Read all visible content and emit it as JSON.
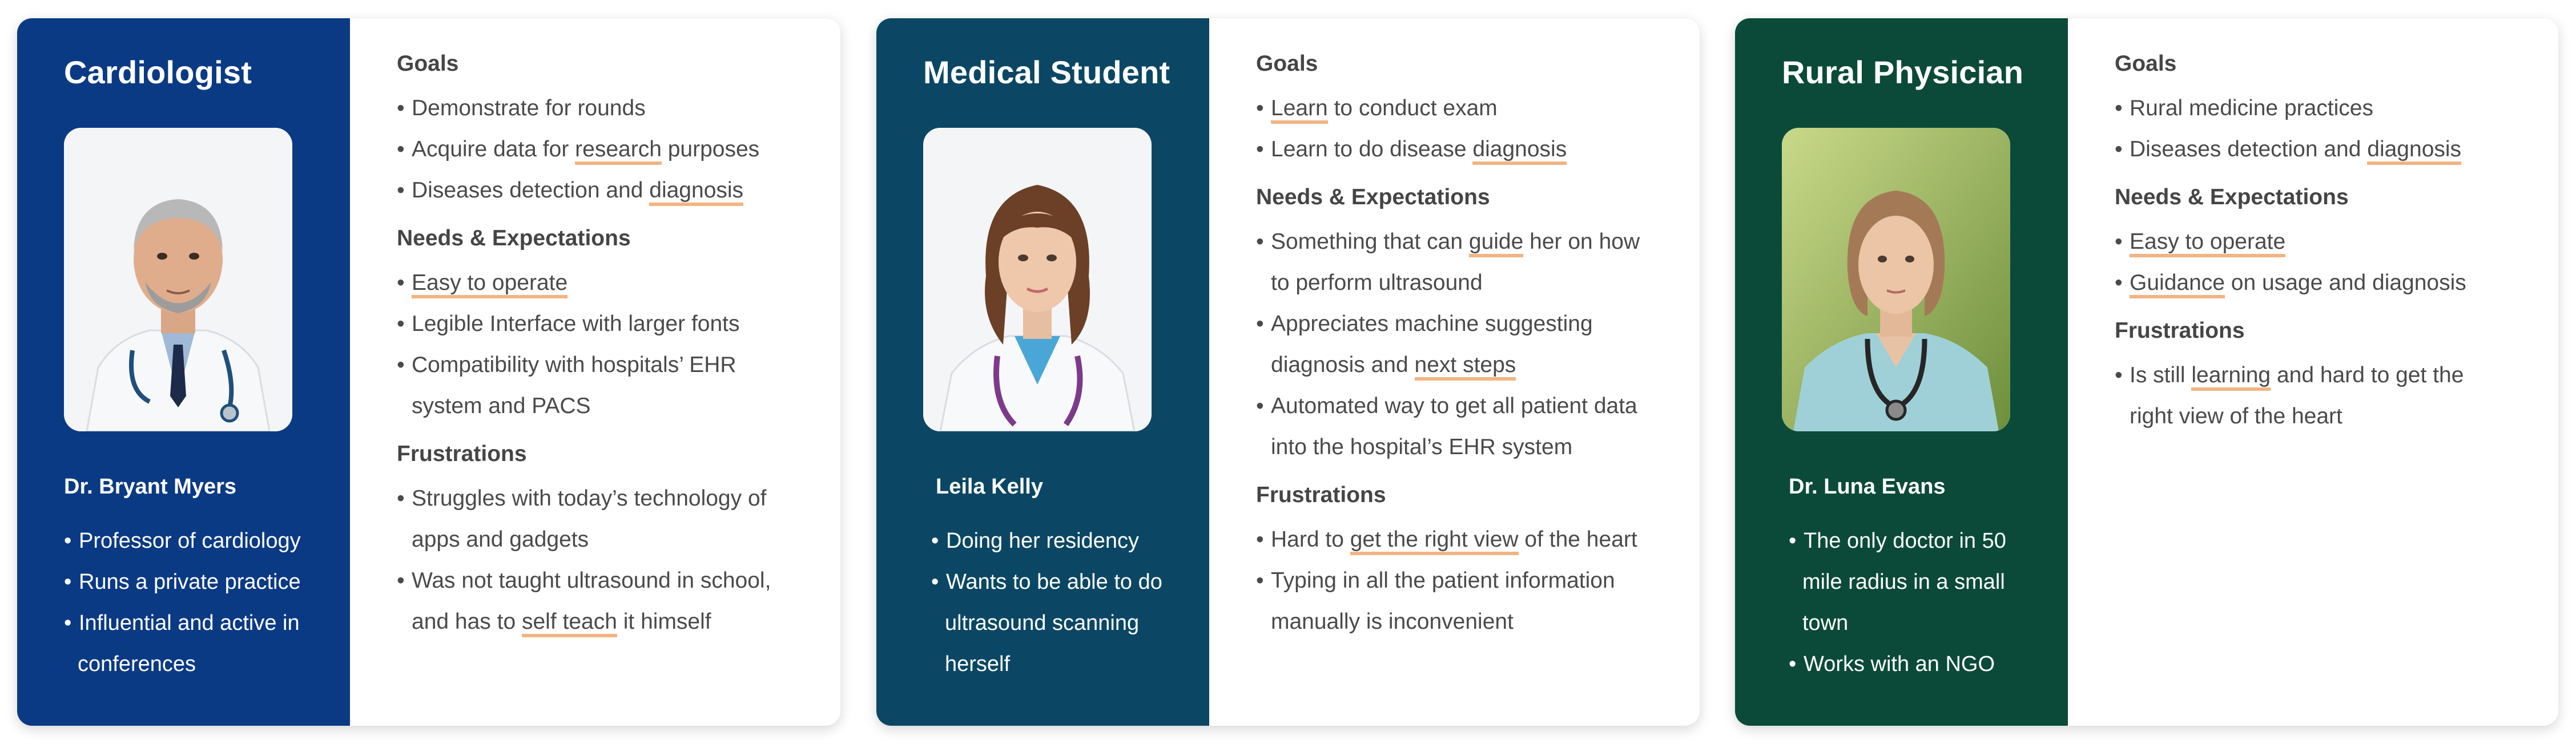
{
  "personas": [
    {
      "role": "Cardiologist",
      "photo_alt": "",
      "name": "Dr. Bryant Myers",
      "about": [
        "Professor of cardiology",
        "Runs a private practice",
        "Influential and active in conferences"
      ],
      "sections": [
        {
          "title": "Goals",
          "items": [
            [
              "Demonstrate for rounds"
            ],
            [
              "Acquire data for ",
              {
                "hl": "research"
              },
              " purposes"
            ],
            [
              "Diseases detection and ",
              {
                "hl": "diagnosis"
              }
            ]
          ]
        },
        {
          "title": "Needs & Expectations",
          "items": [
            [
              {
                "hl": "Easy to operate"
              }
            ],
            [
              "Legible Interface with larger fonts"
            ],
            [
              "Compatibility with hospitals’ EHR system and PACS"
            ]
          ]
        },
        {
          "title": "Frustrations",
          "items": [
            [
              "Struggles with today’s technology of apps and gadgets"
            ],
            [
              "Was not taught ultrasound in school, and has to ",
              {
                "hl": "self teach"
              },
              " it himself"
            ]
          ]
        }
      ],
      "colors": {
        "panel": "#0b3a85"
      }
    },
    {
      "role": "Medical Student",
      "name": "Leila Kelly",
      "about": [
        "Doing her residency",
        "Wants to be able to do ultrasound scanning herself"
      ],
      "sections": [
        {
          "title": "Goals",
          "items": [
            [
              {
                "hl": "Learn"
              },
              " to conduct exam"
            ],
            [
              "Learn to do disease ",
              {
                "hl": "diagnosis"
              }
            ]
          ]
        },
        {
          "title": "Needs & Expectations",
          "items": [
            [
              "Something that can ",
              {
                "hl": "guide"
              },
              " her on how to perform ultrasound"
            ],
            [
              "Appreciates machine suggesting diagnosis and ",
              {
                "hl": "next steps"
              }
            ],
            [
              "Automated way to get all patient data into the hospital’s EHR system"
            ]
          ]
        },
        {
          "title": "Frustrations",
          "items": [
            [
              "Hard to ",
              {
                "hl": "get the right view"
              },
              " of the heart"
            ],
            [
              "Typing in all the patient information manually is inconvenient"
            ]
          ]
        }
      ],
      "colors": {
        "panel": "#0b4764"
      }
    },
    {
      "role": "Rural Physician",
      "name": "Dr. Luna Evans",
      "about": [
        "The only doctor in 50 mile radius in a small town",
        "Works with an NGO"
      ],
      "sections": [
        {
          "title": "Goals",
          "items": [
            [
              "Rural medicine practices"
            ],
            [
              "Diseases detection and ",
              {
                "hl": "diagnosis"
              }
            ]
          ]
        },
        {
          "title": "Needs & Expectations",
          "items": [
            [
              {
                "hl": "Easy to operate"
              }
            ],
            [
              {
                "hl": "Guidance"
              },
              " on usage and diagnosis"
            ]
          ]
        },
        {
          "title": "Frustrations",
          "items": [
            [
              "Is still ",
              {
                "hl": "learning"
              },
              " and hard to get the right view of the heart"
            ]
          ]
        }
      ],
      "colors": {
        "panel": "#0b4a39"
      }
    }
  ],
  "colors": {
    "highlight": "#f2b482",
    "text": "#4a4a4a",
    "card_bg": "#ffffff"
  }
}
